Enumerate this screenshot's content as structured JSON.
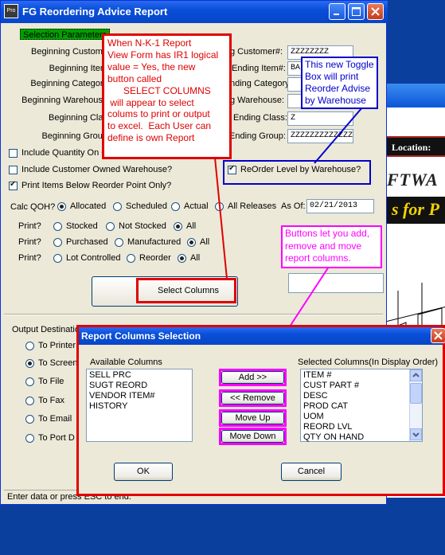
{
  "window": {
    "title": "FG Reordering Advice Report",
    "app_icon_text": "Pro"
  },
  "selection_params": {
    "header": "Selection Parameters",
    "beg_customer": "Beginning Custome",
    "beg_item": "Beginning Item",
    "beg_category": "Beginning Category",
    "beg_warehouse": "Beginning Warehouse",
    "beg_class": "Beginning Clas",
    "beg_group": "Beginning Group",
    "end_customer_label": "g Customer#:",
    "end_customer_value": "ZZZZZZZZ",
    "end_item_label": "Ending Item#:",
    "end_item_value": "BA",
    "end_category_label": "nding Category:",
    "end_warehouse_label": "g Warehouse:",
    "end_class_label": "Ending Class:",
    "end_class_value": "Z",
    "end_group_label": "Ending Group:",
    "end_group_value": "ZZZZZZZZZZZZZZ"
  },
  "options": {
    "include_qty_on_order": "Include Quantity On O",
    "include_customer_owned": "Include Customer Owned Warehouse?",
    "print_below_reorder": "Print Items Below Reorder Point Only?",
    "reorder_by_warehouse": "ReOrder Level by Warehouse?"
  },
  "calc": {
    "label": "Calc QOH?",
    "allocated": "Allocated",
    "scheduled": "Scheduled",
    "actual": "Actual",
    "all_releases": "All Releases",
    "as_of_label": "As Of:",
    "as_of_value": "02/21/2013"
  },
  "print_rows": {
    "print_label": "Print?",
    "stocked": "Stocked",
    "not_stocked": "Not Stocked",
    "all": "All",
    "purchased": "Purchased",
    "manufactured": "Manufactured",
    "lot_controlled": "Lot Controlled",
    "reorder": "Reorder"
  },
  "select_columns_label": "Select Columns",
  "output": {
    "header": "Output Destinatio",
    "to_printer": "To Printer",
    "to_screen": "To Screen",
    "to_file": "To File",
    "to_fax": "To Fax",
    "to_email": "To Email",
    "to_port": "To Port D"
  },
  "status_bar": "Enter data or press ESC to end.",
  "callouts": {
    "red": "When N-K-1 Report\nView Form has IR1 logical\nvalue = Yes, the new\nbutton called\n      SELECT COLUMNS\n will appear to select\ncolums to print or output\nto excel.  Each User can\ndefine is own Report",
    "blue": "This new Toggle\nBox will print\nReorder Advise\nby Warehouse",
    "magenta": "Buttons let you add,\nremove and move\nreport columns."
  },
  "dialog": {
    "title": "Report Columns Selection",
    "available_header": "Available Columns",
    "available": [
      "SELL PRC",
      "SUGT REORD",
      "VENDOR ITEM#",
      "HISTORY"
    ],
    "selected_header": "Selected Columns(In Display Order)",
    "selected": [
      "ITEM #",
      "CUST PART #",
      "DESC",
      "PROD CAT",
      "UOM",
      "REORD LVL",
      "QTY ON HAND"
    ],
    "add": "Add >>",
    "remove": "<< Remove",
    "move_up": "Move Up",
    "move_down": "Move Down",
    "ok": "OK",
    "cancel": "Cancel"
  },
  "background_app": {
    "location_label": "Location:",
    "logo_text_1": "FTWA",
    "logo_text_2": "s for P"
  },
  "colors": {
    "annotation_red": "#e00000",
    "annotation_blue": "#0000cc",
    "annotation_magenta": "#ff00ff",
    "title_blue": "#0a4fd8"
  }
}
